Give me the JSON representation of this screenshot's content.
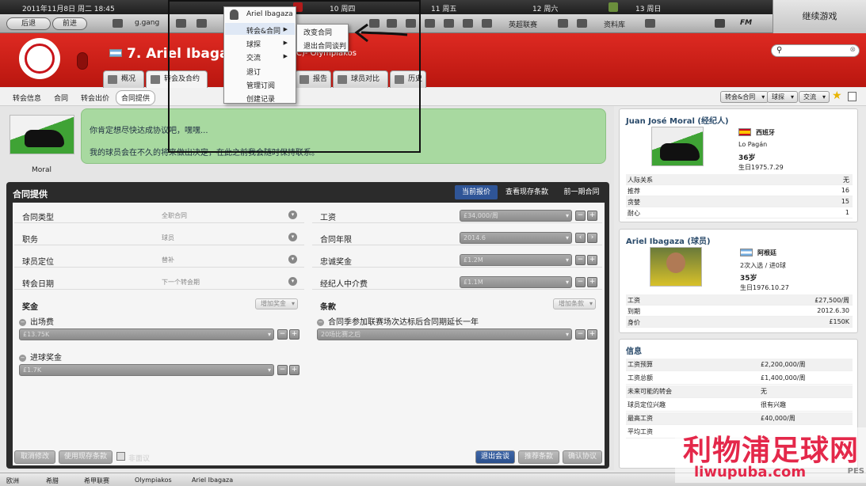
{
  "topbar": {
    "date": "2011年11月8日 周二 18:45",
    "days": [
      "10 周四",
      "11 周五",
      "12 周六",
      "13 周日"
    ]
  },
  "nav": {
    "back": "后退",
    "forward": "前进",
    "manager": "g.gang",
    "league": "英超联赛",
    "database": "资料库",
    "fm": "FM",
    "continue": "继续游戏"
  },
  "player": {
    "title": "7. Ariel Ibagaza",
    "club": "(C)- Olympiakos"
  },
  "tabs": [
    "概况",
    "转会及合约",
    "报告",
    "球员对比",
    "历史"
  ],
  "subnav": [
    "转会信息",
    "合同",
    "转会出价",
    "合同提供"
  ],
  "right_menus": [
    "转会&合同",
    "球探",
    "交流"
  ],
  "agent_thumb": "Moral",
  "message": [
    "你肯定想尽快达成协议吧，嘿嘿...",
    "我的球员会在不久的将来做出决定，在此之前我会随时保持联系。"
  ],
  "contract": {
    "title": "合同提供",
    "tabs": [
      "当前报价",
      "查看现存条款",
      "前一期合同"
    ],
    "left_rows": [
      {
        "label": "合同类型",
        "value": "全职合同"
      },
      {
        "label": "职务",
        "value": "球员"
      },
      {
        "label": "球员定位",
        "value": "替补"
      },
      {
        "label": "转会日期",
        "value": "下一个转会期"
      }
    ],
    "right_rows": [
      {
        "label": "工资",
        "value": "£34,000/周"
      },
      {
        "label": "合同年限",
        "value": "2014.6"
      },
      {
        "label": "忠诚奖金",
        "value": "£1.2M"
      },
      {
        "label": "经纪人中介费",
        "value": "£1.1M"
      }
    ],
    "bonus_title": "奖金",
    "add_bonus": "增加奖金",
    "clause_title": "条款",
    "add_clause": "增加条款",
    "appearance_fee": "出场费",
    "appearance_value": "£13.75K",
    "goal_bonus": "进球奖金",
    "goal_value": "£1.7K",
    "clause": "合同季参加联赛场次达标后合同期延长一年",
    "clause_value": "20场比赛之后",
    "buttons": {
      "cancel": "取消修改",
      "use_existing": "使用现存条款",
      "non_public": "非面议",
      "leave": "退出会谈",
      "recommend": "推荐条款",
      "confirm": "确认协议"
    }
  },
  "agent_card": {
    "title": "Juan José Moral (经纪人)",
    "nation": "西班牙",
    "location": "Lo Pagán",
    "age": "36岁",
    "birth": "生日1975.7.29",
    "rows": [
      [
        "人际关系",
        "无"
      ],
      [
        "推荐",
        "16"
      ],
      [
        "贪婪",
        "15"
      ],
      [
        "耐心",
        "1"
      ]
    ]
  },
  "player_card": {
    "title": "Ariel Ibagaza (球员)",
    "nation": "阿根廷",
    "caps": "2次入选 / 进0球",
    "age": "35岁",
    "birth": "生日1976.10.27",
    "rows": [
      [
        "工资",
        "£27,500/周"
      ],
      [
        "到期",
        "2012.6.30"
      ],
      [
        "身价",
        "£150K"
      ]
    ]
  },
  "info_card": {
    "title": "信息",
    "rows": [
      [
        "工资预算",
        "£2,200,000/周"
      ],
      [
        "工资总额",
        "£1,400,000/周"
      ],
      [
        "未来可能的转会",
        "无"
      ],
      [
        "球员定位兴趣",
        "很有兴趣"
      ],
      [
        "最高工资",
        "£40,000/周"
      ],
      [
        "平均工资",
        ""
      ]
    ]
  },
  "context_menu": {
    "header": "Ariel Ibagaza",
    "items": [
      "转会&合同",
      "球探",
      "交流",
      "退订",
      "管理订阅",
      "创建记录"
    ]
  },
  "submenu": [
    "改变合同",
    "退出合同谈判"
  ],
  "bottombar": [
    "欧洲",
    "希腊",
    "希甲联赛",
    "Olympiakos",
    "Ariel Ibagaza"
  ],
  "watermark": {
    "cn": "利物浦足球网",
    "url": "liwupuba.com",
    "corner": "PES"
  },
  "colors": {
    "club_red": "#c8141a",
    "bubble_green": "#a8d9a0",
    "dark_panel": "#2b2b2b",
    "accent_blue": "#2f5597"
  },
  "icons": [
    "home-icon",
    "help-icon",
    "star-icon",
    "search-icon",
    "chevron-down-icon",
    "arrow-left-annotation"
  ]
}
